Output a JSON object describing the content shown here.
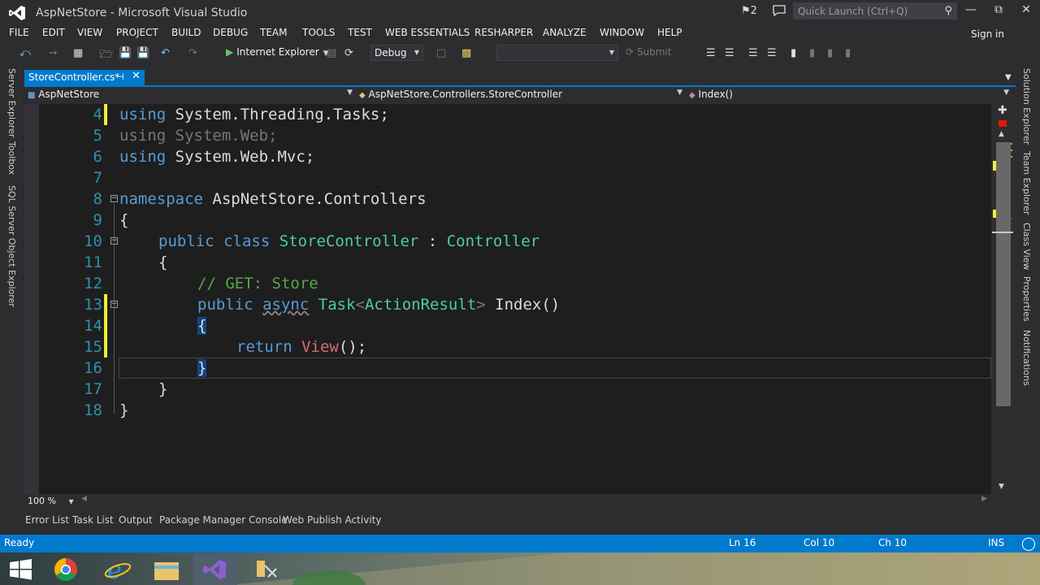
{
  "window": {
    "title": "AspNetStore - Microsoft Visual Studio",
    "notification_count": "2",
    "quick_launch_placeholder": "Quick Launch (Ctrl+Q)"
  },
  "menu": {
    "items": [
      "FILE",
      "EDIT",
      "VIEW",
      "PROJECT",
      "BUILD",
      "DEBUG",
      "TEAM",
      "TOOLS",
      "TEST",
      "WEB ESSENTIALS",
      "RESHARPER",
      "ANALYZE",
      "WINDOW",
      "HELP"
    ],
    "sign_in": "Sign in"
  },
  "toolbar": {
    "run_label": "Internet Explorer",
    "configuration": "Debug",
    "submit_label": "Submit"
  },
  "left_tool_windows": [
    "Server Explorer",
    "Toolbox",
    "SQL Server Object Explorer"
  ],
  "right_tool_windows": [
    "Solution Explorer",
    "Team Explorer",
    "Class View",
    "Properties",
    "Notifications"
  ],
  "document_tab": {
    "name": "StoreController.cs*"
  },
  "navigation": {
    "project": "AspNetStore",
    "type": "AspNetStore.Controllers.StoreController",
    "member": "Index()"
  },
  "editor": {
    "lines": [
      {
        "n": "4"
      },
      {
        "n": "5"
      },
      {
        "n": "6"
      },
      {
        "n": "7"
      },
      {
        "n": "8"
      },
      {
        "n": "9"
      },
      {
        "n": "10"
      },
      {
        "n": "11"
      },
      {
        "n": "12"
      },
      {
        "n": "13"
      },
      {
        "n": "14"
      },
      {
        "n": "15"
      },
      {
        "n": "16"
      },
      {
        "n": "17"
      },
      {
        "n": "18"
      }
    ],
    "tokens": {
      "using": "using",
      "ns_threading": "System.Threading.Tasks;",
      "ns_web": "System.Web;",
      "ns_mvc": "System.Web.Mvc;",
      "namespace_kw": "namespace",
      "namespace_name": "AspNetStore.Controllers",
      "open_brace": "{",
      "close_brace": "}",
      "public": "public",
      "class": "class",
      "class_name": "StoreController",
      "colon": ":",
      "base_class": "Controller",
      "comment": "// GET: Store",
      "async": "async",
      "task": "Task",
      "lt": "<",
      "action_result": "ActionResult",
      "gt": ">",
      "method": "Index()",
      "return": "return",
      "view": "View",
      "call_end": "();"
    },
    "zoom": "100 %"
  },
  "bottom_tabs": [
    "Error List",
    "Task List",
    "Output",
    "Package Manager Console",
    "Web Publish Activity"
  ],
  "status": {
    "state": "Ready",
    "line": "Ln 16",
    "col": "Col 10",
    "ch": "Ch 10",
    "mode": "INS"
  },
  "colors": {
    "accent": "#007acc",
    "keyword": "#569cd6",
    "type": "#4ec9b0",
    "comment": "#57a64a"
  }
}
